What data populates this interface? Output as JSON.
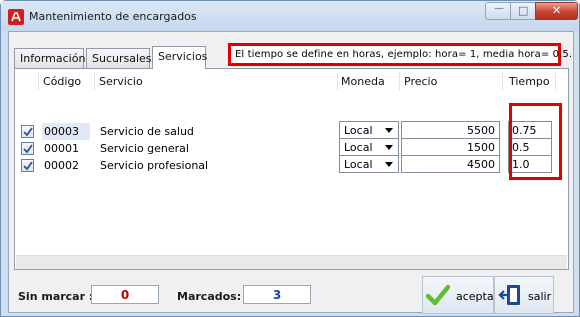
{
  "window": {
    "title": "Mantenimiento de encargados",
    "minimize_glyph": "—",
    "maximize_glyph": "□",
    "close_glyph": "✕"
  },
  "tabs": [
    {
      "label": "Información",
      "active": false
    },
    {
      "label": "Sucursales",
      "active": false
    },
    {
      "label": "Servicios",
      "active": true
    }
  ],
  "note": "El tiempo se define en horas, ejemplo: hora= 1, media hora= 0.5.",
  "table": {
    "columns": [
      "",
      "Código",
      "Servicio",
      "Moneda",
      "Precio",
      "Tiempo"
    ],
    "rows": [
      {
        "checked": true,
        "codigo": "00003",
        "servicio": "Servicio de salud",
        "moneda": "Local",
        "precio": "5500",
        "tiempo": "0.75"
      },
      {
        "checked": true,
        "codigo": "00001",
        "servicio": "Servicio general",
        "moneda": "Local",
        "precio": "1500",
        "tiempo": "0.5"
      },
      {
        "checked": true,
        "codigo": "00002",
        "servicio": "Servicio profesional",
        "moneda": "Local",
        "precio": "4500",
        "tiempo": "1.0"
      }
    ]
  },
  "footer": {
    "unchecked_label": "Sin marcar :",
    "unchecked_value": "0",
    "checked_label": "Marcados:",
    "checked_value": "3",
    "accept_label": "aceptar",
    "exit_label": "salir"
  },
  "colors": {
    "unchecked_value": "#c00000",
    "checked_value": "#1f3fbf",
    "highlight_border": "#e00000",
    "accept_icon": "#5cc12c",
    "exit_icon": "#1c4b8c"
  },
  "icons": {
    "app": "app-logo-icon",
    "check": "check-mark-icon",
    "dropdown": "dropdown-arrow-icon",
    "accept": "accept-checkmark-icon",
    "exit": "exit-door-icon"
  }
}
